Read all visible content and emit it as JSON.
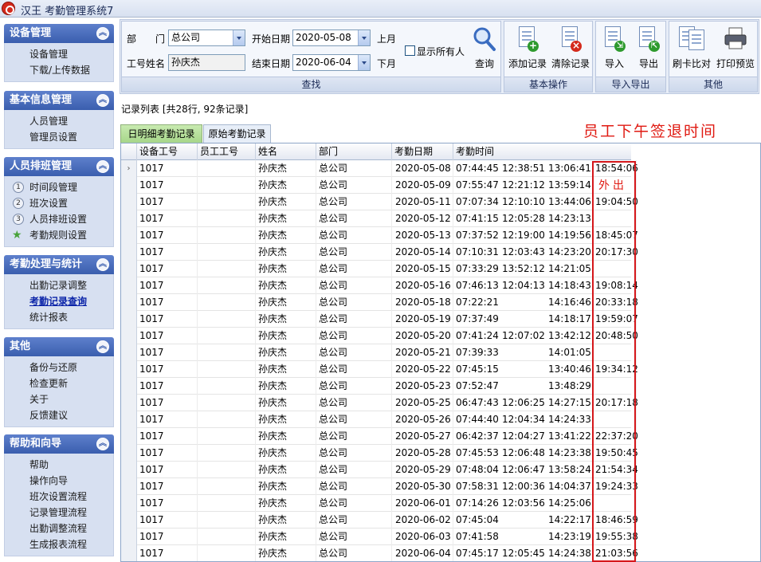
{
  "window": {
    "title": "汉王 考勤管理系统7"
  },
  "sidebar": {
    "groups": [
      {
        "title": "设备管理",
        "items": [
          "设备管理",
          "下载/上传数据"
        ]
      },
      {
        "title": "基本信息管理",
        "items": [
          "人员管理",
          "管理员设置"
        ]
      },
      {
        "title": "人员排班管理",
        "items": [
          "时间段管理",
          "班次设置",
          "人员排班设置",
          "考勤规则设置"
        ],
        "markers": [
          "1",
          "2",
          "3"
        ]
      },
      {
        "title": "考勤处理与统计",
        "items": [
          "出勤记录调整",
          "考勤记录查询",
          "统计报表"
        ],
        "active": "考勤记录查询"
      },
      {
        "title": "其他",
        "items": [
          "备份与还原",
          "检查更新",
          "关于",
          "反馈建议"
        ]
      },
      {
        "title": "帮助和向导",
        "items": [
          "帮助",
          "操作向导",
          "班次设置流程",
          "记录管理流程",
          "出勤调整流程",
          "生成报表流程"
        ]
      }
    ]
  },
  "search": {
    "dept_label": "部　　门",
    "dept_value": "总公司",
    "name_label": "工号姓名",
    "name_value": "孙庆杰",
    "start_label": "开始日期",
    "start_value": "2020-05-08",
    "end_label": "结束日期",
    "end_value": "2020-06-04",
    "prev_month": "上月",
    "next_month": "下月",
    "show_all_label": "显示所有人",
    "show_all_checked": false,
    "query_label": "查询",
    "panel_label": "查找"
  },
  "toolbar": {
    "add_label": "添加记录",
    "clear_label": "清除记录",
    "basic_panel": "基本操作",
    "import_label": "导入",
    "export_label": "导出",
    "io_panel": "导入导出",
    "compare_label": "刷卡比对",
    "print_label": "打印预览",
    "other_panel": "其他"
  },
  "list": {
    "summary": "记录列表 [共28行, 92条记录]",
    "tabs": [
      "日明细考勤记录",
      "原始考勤记录"
    ],
    "active_tab": 0,
    "annotation": "员工下午签退时间",
    "out_note": "外出",
    "columns": [
      "设备工号",
      "员工工号",
      "姓名",
      "部门",
      "考勤日期",
      "考勤时间"
    ],
    "rows": [
      [
        "1017",
        "",
        "孙庆杰",
        "总公司",
        "2020-05-08",
        "07:44:45",
        "12:38:51",
        "13:06:41",
        "18:54:06"
      ],
      [
        "1017",
        "",
        "孙庆杰",
        "总公司",
        "2020-05-09",
        "07:55:47",
        "12:21:12",
        "13:59:14",
        ""
      ],
      [
        "1017",
        "",
        "孙庆杰",
        "总公司",
        "2020-05-11",
        "07:07:34",
        "12:10:10",
        "13:44:06",
        "19:04:50"
      ],
      [
        "1017",
        "",
        "孙庆杰",
        "总公司",
        "2020-05-12",
        "07:41:15",
        "12:05:28",
        "14:23:13",
        ""
      ],
      [
        "1017",
        "",
        "孙庆杰",
        "总公司",
        "2020-05-13",
        "07:37:52",
        "12:19:00",
        "14:19:56",
        "18:45:07"
      ],
      [
        "1017",
        "",
        "孙庆杰",
        "总公司",
        "2020-05-14",
        "07:10:31",
        "12:03:43",
        "14:23:20",
        "20:17:30"
      ],
      [
        "1017",
        "",
        "孙庆杰",
        "总公司",
        "2020-05-15",
        "07:33:29",
        "13:52:12",
        "14:21:05",
        ""
      ],
      [
        "1017",
        "",
        "孙庆杰",
        "总公司",
        "2020-05-16",
        "07:46:13",
        "12:04:13",
        "14:18:43",
        "19:08:14"
      ],
      [
        "1017",
        "",
        "孙庆杰",
        "总公司",
        "2020-05-18",
        "07:22:21",
        "",
        "14:16:46",
        "20:33:18"
      ],
      [
        "1017",
        "",
        "孙庆杰",
        "总公司",
        "2020-05-19",
        "07:37:49",
        "",
        "14:18:17",
        "19:59:07"
      ],
      [
        "1017",
        "",
        "孙庆杰",
        "总公司",
        "2020-05-20",
        "07:41:24",
        "12:07:02",
        "13:42:12",
        "20:48:50"
      ],
      [
        "1017",
        "",
        "孙庆杰",
        "总公司",
        "2020-05-21",
        "07:39:33",
        "",
        "14:01:05",
        ""
      ],
      [
        "1017",
        "",
        "孙庆杰",
        "总公司",
        "2020-05-22",
        "07:45:15",
        "",
        "13:40:46",
        "19:34:12"
      ],
      [
        "1017",
        "",
        "孙庆杰",
        "总公司",
        "2020-05-23",
        "07:52:47",
        "",
        "13:48:29",
        ""
      ],
      [
        "1017",
        "",
        "孙庆杰",
        "总公司",
        "2020-05-25",
        "06:47:43",
        "12:06:25",
        "14:27:15",
        "20:17:18"
      ],
      [
        "1017",
        "",
        "孙庆杰",
        "总公司",
        "2020-05-26",
        "07:44:40",
        "12:04:34",
        "14:24:33",
        ""
      ],
      [
        "1017",
        "",
        "孙庆杰",
        "总公司",
        "2020-05-27",
        "06:42:37",
        "12:04:27",
        "13:41:22",
        "22:37:20"
      ],
      [
        "1017",
        "",
        "孙庆杰",
        "总公司",
        "2020-05-28",
        "07:45:53",
        "12:06:48",
        "14:23:38",
        "19:50:45"
      ],
      [
        "1017",
        "",
        "孙庆杰",
        "总公司",
        "2020-05-29",
        "07:48:04",
        "12:06:47",
        "13:58:24",
        "21:54:34"
      ],
      [
        "1017",
        "",
        "孙庆杰",
        "总公司",
        "2020-05-30",
        "07:58:31",
        "12:00:36",
        "14:04:37",
        "19:24:33"
      ],
      [
        "1017",
        "",
        "孙庆杰",
        "总公司",
        "2020-06-01",
        "07:14:26",
        "12:03:56",
        "14:25:06",
        ""
      ],
      [
        "1017",
        "",
        "孙庆杰",
        "总公司",
        "2020-06-02",
        "07:45:04",
        "",
        "14:22:17",
        "18:46:59"
      ],
      [
        "1017",
        "",
        "孙庆杰",
        "总公司",
        "2020-06-03",
        "07:41:58",
        "",
        "14:23:19",
        "19:55:38"
      ],
      [
        "1017",
        "",
        "孙庆杰",
        "总公司",
        "2020-06-04",
        "07:45:17",
        "12:05:45",
        "14:24:38",
        "21:03:56"
      ]
    ]
  },
  "colors": {
    "accent": "#3a5eae",
    "highlight": "#d5171b",
    "active_tab": "#a7d68a"
  }
}
